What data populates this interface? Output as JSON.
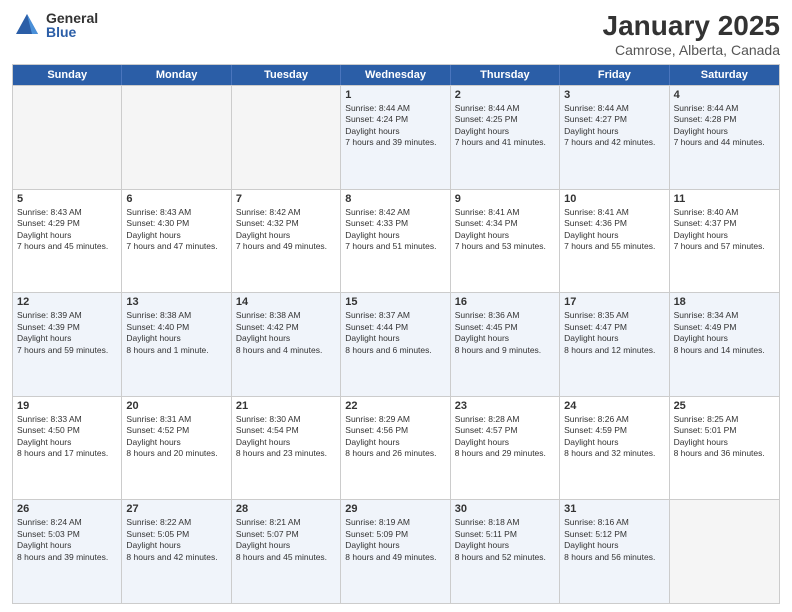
{
  "header": {
    "logo": {
      "general": "General",
      "blue": "Blue"
    },
    "title": "January 2025",
    "subtitle": "Camrose, Alberta, Canada"
  },
  "days": [
    "Sunday",
    "Monday",
    "Tuesday",
    "Wednesday",
    "Thursday",
    "Friday",
    "Saturday"
  ],
  "rows": [
    [
      {
        "day": "",
        "empty": true
      },
      {
        "day": "",
        "empty": true
      },
      {
        "day": "",
        "empty": true
      },
      {
        "day": "1",
        "sunrise": "8:44 AM",
        "sunset": "4:24 PM",
        "daylight": "7 hours and 39 minutes."
      },
      {
        "day": "2",
        "sunrise": "8:44 AM",
        "sunset": "4:25 PM",
        "daylight": "7 hours and 41 minutes."
      },
      {
        "day": "3",
        "sunrise": "8:44 AM",
        "sunset": "4:27 PM",
        "daylight": "7 hours and 42 minutes."
      },
      {
        "day": "4",
        "sunrise": "8:44 AM",
        "sunset": "4:28 PM",
        "daylight": "7 hours and 44 minutes."
      }
    ],
    [
      {
        "day": "5",
        "sunrise": "8:43 AM",
        "sunset": "4:29 PM",
        "daylight": "7 hours and 45 minutes."
      },
      {
        "day": "6",
        "sunrise": "8:43 AM",
        "sunset": "4:30 PM",
        "daylight": "7 hours and 47 minutes."
      },
      {
        "day": "7",
        "sunrise": "8:42 AM",
        "sunset": "4:32 PM",
        "daylight": "7 hours and 49 minutes."
      },
      {
        "day": "8",
        "sunrise": "8:42 AM",
        "sunset": "4:33 PM",
        "daylight": "7 hours and 51 minutes."
      },
      {
        "day": "9",
        "sunrise": "8:41 AM",
        "sunset": "4:34 PM",
        "daylight": "7 hours and 53 minutes."
      },
      {
        "day": "10",
        "sunrise": "8:41 AM",
        "sunset": "4:36 PM",
        "daylight": "7 hours and 55 minutes."
      },
      {
        "day": "11",
        "sunrise": "8:40 AM",
        "sunset": "4:37 PM",
        "daylight": "7 hours and 57 minutes."
      }
    ],
    [
      {
        "day": "12",
        "sunrise": "8:39 AM",
        "sunset": "4:39 PM",
        "daylight": "7 hours and 59 minutes."
      },
      {
        "day": "13",
        "sunrise": "8:38 AM",
        "sunset": "4:40 PM",
        "daylight": "8 hours and 1 minute."
      },
      {
        "day": "14",
        "sunrise": "8:38 AM",
        "sunset": "4:42 PM",
        "daylight": "8 hours and 4 minutes."
      },
      {
        "day": "15",
        "sunrise": "8:37 AM",
        "sunset": "4:44 PM",
        "daylight": "8 hours and 6 minutes."
      },
      {
        "day": "16",
        "sunrise": "8:36 AM",
        "sunset": "4:45 PM",
        "daylight": "8 hours and 9 minutes."
      },
      {
        "day": "17",
        "sunrise": "8:35 AM",
        "sunset": "4:47 PM",
        "daylight": "8 hours and 12 minutes."
      },
      {
        "day": "18",
        "sunrise": "8:34 AM",
        "sunset": "4:49 PM",
        "daylight": "8 hours and 14 minutes."
      }
    ],
    [
      {
        "day": "19",
        "sunrise": "8:33 AM",
        "sunset": "4:50 PM",
        "daylight": "8 hours and 17 minutes."
      },
      {
        "day": "20",
        "sunrise": "8:31 AM",
        "sunset": "4:52 PM",
        "daylight": "8 hours and 20 minutes."
      },
      {
        "day": "21",
        "sunrise": "8:30 AM",
        "sunset": "4:54 PM",
        "daylight": "8 hours and 23 minutes."
      },
      {
        "day": "22",
        "sunrise": "8:29 AM",
        "sunset": "4:56 PM",
        "daylight": "8 hours and 26 minutes."
      },
      {
        "day": "23",
        "sunrise": "8:28 AM",
        "sunset": "4:57 PM",
        "daylight": "8 hours and 29 minutes."
      },
      {
        "day": "24",
        "sunrise": "8:26 AM",
        "sunset": "4:59 PM",
        "daylight": "8 hours and 32 minutes."
      },
      {
        "day": "25",
        "sunrise": "8:25 AM",
        "sunset": "5:01 PM",
        "daylight": "8 hours and 36 minutes."
      }
    ],
    [
      {
        "day": "26",
        "sunrise": "8:24 AM",
        "sunset": "5:03 PM",
        "daylight": "8 hours and 39 minutes."
      },
      {
        "day": "27",
        "sunrise": "8:22 AM",
        "sunset": "5:05 PM",
        "daylight": "8 hours and 42 minutes."
      },
      {
        "day": "28",
        "sunrise": "8:21 AM",
        "sunset": "5:07 PM",
        "daylight": "8 hours and 45 minutes."
      },
      {
        "day": "29",
        "sunrise": "8:19 AM",
        "sunset": "5:09 PM",
        "daylight": "8 hours and 49 minutes."
      },
      {
        "day": "30",
        "sunrise": "8:18 AM",
        "sunset": "5:11 PM",
        "daylight": "8 hours and 52 minutes."
      },
      {
        "day": "31",
        "sunrise": "8:16 AM",
        "sunset": "5:12 PM",
        "daylight": "8 hours and 56 minutes."
      },
      {
        "day": "",
        "empty": true
      }
    ]
  ]
}
